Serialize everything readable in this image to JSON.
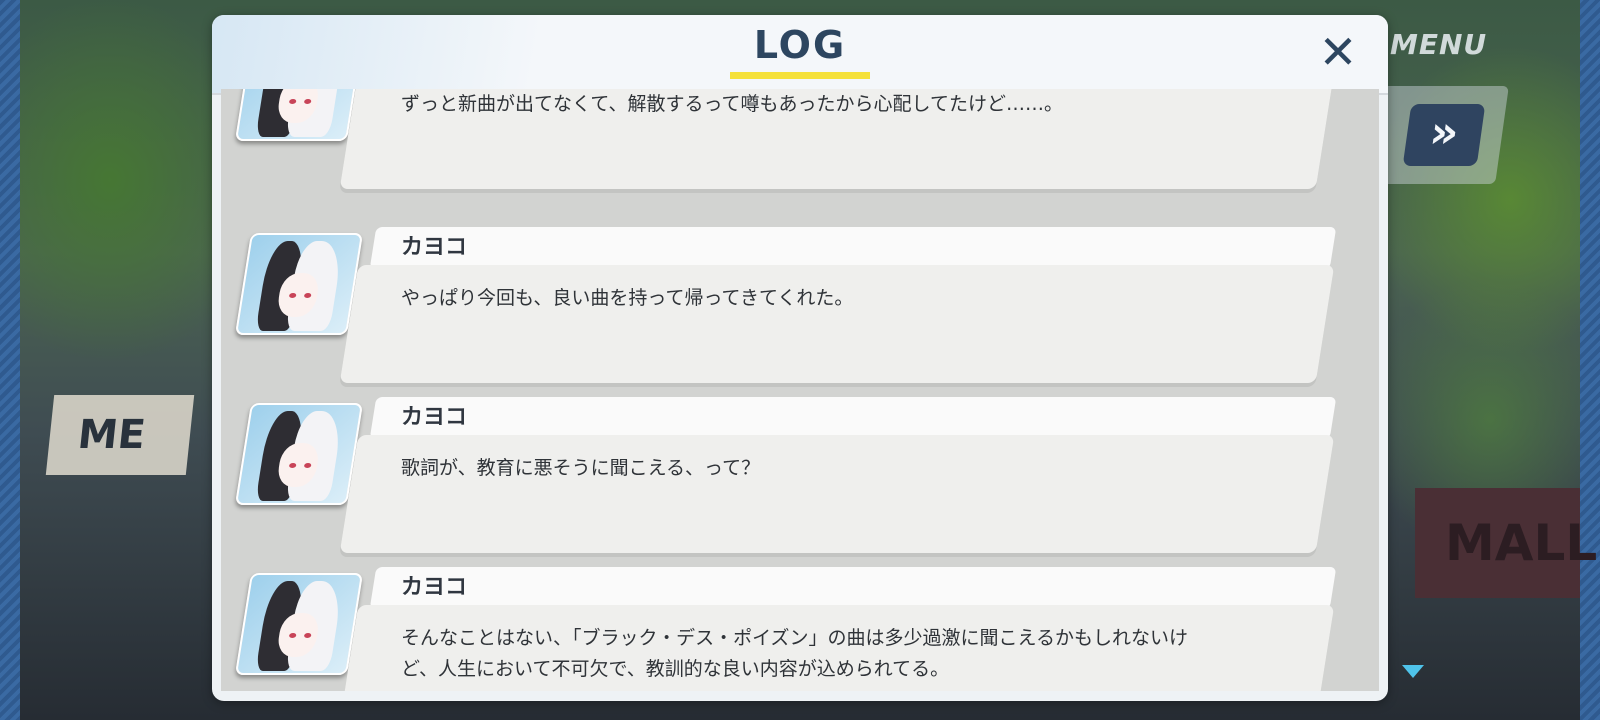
{
  "background": {
    "sign_text": "ME",
    "mall_text": "MALL"
  },
  "overlay": {
    "menu_label": "MENU",
    "skip_symbol": "»",
    "scroll_down_icon": "triangle-down"
  },
  "log": {
    "title": "LOG",
    "close_symbol": "✕",
    "accent_color": "#f5e13a",
    "entries": [
      {
        "speaker": "",
        "text": "ずっと新曲が出てなくて、解散するって噂もあったから心配してたけど……。"
      },
      {
        "speaker": "カヨコ",
        "text": "やっぱり今回も、良い曲を持って帰ってきてくれた。"
      },
      {
        "speaker": "カヨコ",
        "text": "歌詞が、教育に悪そうに聞こえる、って？"
      },
      {
        "speaker": "カヨコ",
        "text": "そんなことはない、「ブラック・デス・ポイズン」の曲は多少過激に聞こえるかもしれないけど、人生において不可欠で、教訓的な良い内容が込められてる。"
      }
    ]
  }
}
